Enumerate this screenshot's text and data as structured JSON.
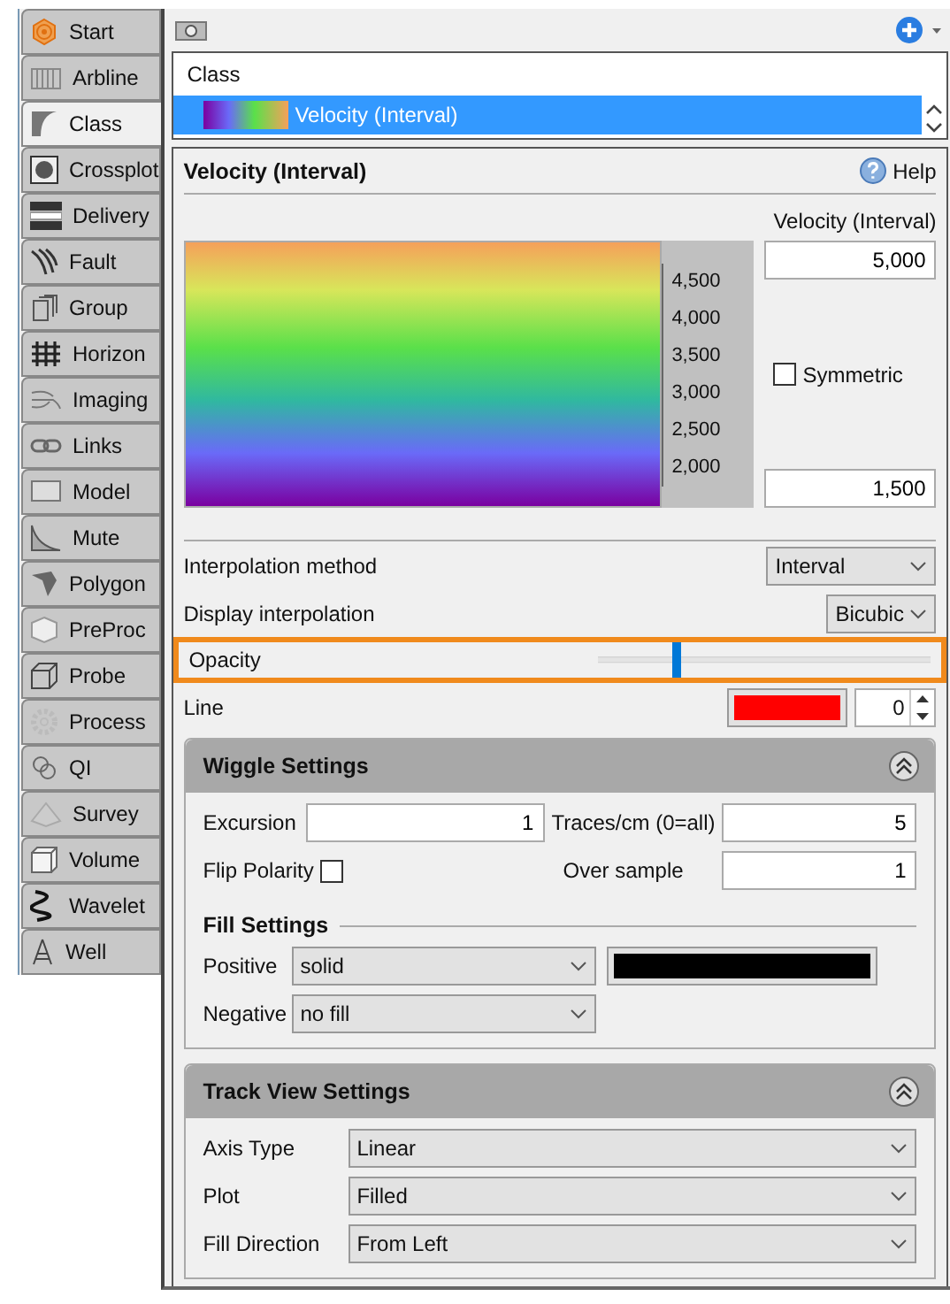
{
  "sidebar": {
    "items": [
      {
        "label": "Start",
        "selected": false
      },
      {
        "label": "Arbline",
        "selected": false
      },
      {
        "label": "Class",
        "selected": true
      },
      {
        "label": "Crossplot",
        "selected": false
      },
      {
        "label": "Delivery",
        "selected": false
      },
      {
        "label": "Fault",
        "selected": false
      },
      {
        "label": "Group",
        "selected": false
      },
      {
        "label": "Horizon",
        "selected": false
      },
      {
        "label": "Imaging",
        "selected": false
      },
      {
        "label": "Links",
        "selected": false
      },
      {
        "label": "Model",
        "selected": false
      },
      {
        "label": "Mute",
        "selected": false
      },
      {
        "label": "Polygon",
        "selected": false
      },
      {
        "label": "PreProc",
        "selected": false
      },
      {
        "label": "Probe",
        "selected": false
      },
      {
        "label": "Process",
        "selected": false
      },
      {
        "label": "QI",
        "selected": false
      },
      {
        "label": "Survey",
        "selected": false
      },
      {
        "label": "Volume",
        "selected": false
      },
      {
        "label": "Wavelet",
        "selected": false
      },
      {
        "label": "Well",
        "selected": false
      }
    ]
  },
  "class_list": {
    "header": "Class",
    "items": [
      {
        "label": "Velocity (Interval)",
        "selected": true
      }
    ]
  },
  "panel": {
    "title": "Velocity (Interval)",
    "help": "Help"
  },
  "colormap": {
    "name": "Velocity (Interval)",
    "ticks": [
      "4,500",
      "4,000",
      "3,500",
      "3,000",
      "2,500",
      "2,000"
    ],
    "max": "5,000",
    "min": "1,500",
    "symmetric_label": "Symmetric",
    "symmetric": false
  },
  "interpolation_method": {
    "label": "Interpolation method",
    "value": "Interval"
  },
  "display_interpolation": {
    "label": "Display interpolation",
    "value": "Bicubic"
  },
  "opacity": {
    "label": "Opacity",
    "level": 0.23,
    "highlighted": true
  },
  "line": {
    "label": "Line",
    "color": "#ff0000",
    "value": "0"
  },
  "wiggle_settings": {
    "title": "Wiggle Settings",
    "expanded": true,
    "excursion": {
      "label": "Excursion",
      "value": "1"
    },
    "traces": {
      "label": "Traces/cm (0=all)",
      "value": "5"
    },
    "flip_polarity": {
      "label": "Flip Polarity",
      "checked": false
    },
    "over_sample": {
      "label": "Over sample",
      "value": "1"
    },
    "fill_settings": {
      "title": "Fill Settings",
      "positive": {
        "label": "Positive",
        "value": "solid",
        "color": "#000000"
      },
      "negative": {
        "label": "Negative",
        "value": "no fill"
      }
    }
  },
  "track_view_settings": {
    "title": "Track View Settings",
    "expanded": true,
    "fields": [
      {
        "label": "Axis Type",
        "value": "Linear"
      },
      {
        "label": "Plot",
        "value": "Filled"
      },
      {
        "label": "Fill Direction",
        "value": "From Left"
      }
    ]
  }
}
